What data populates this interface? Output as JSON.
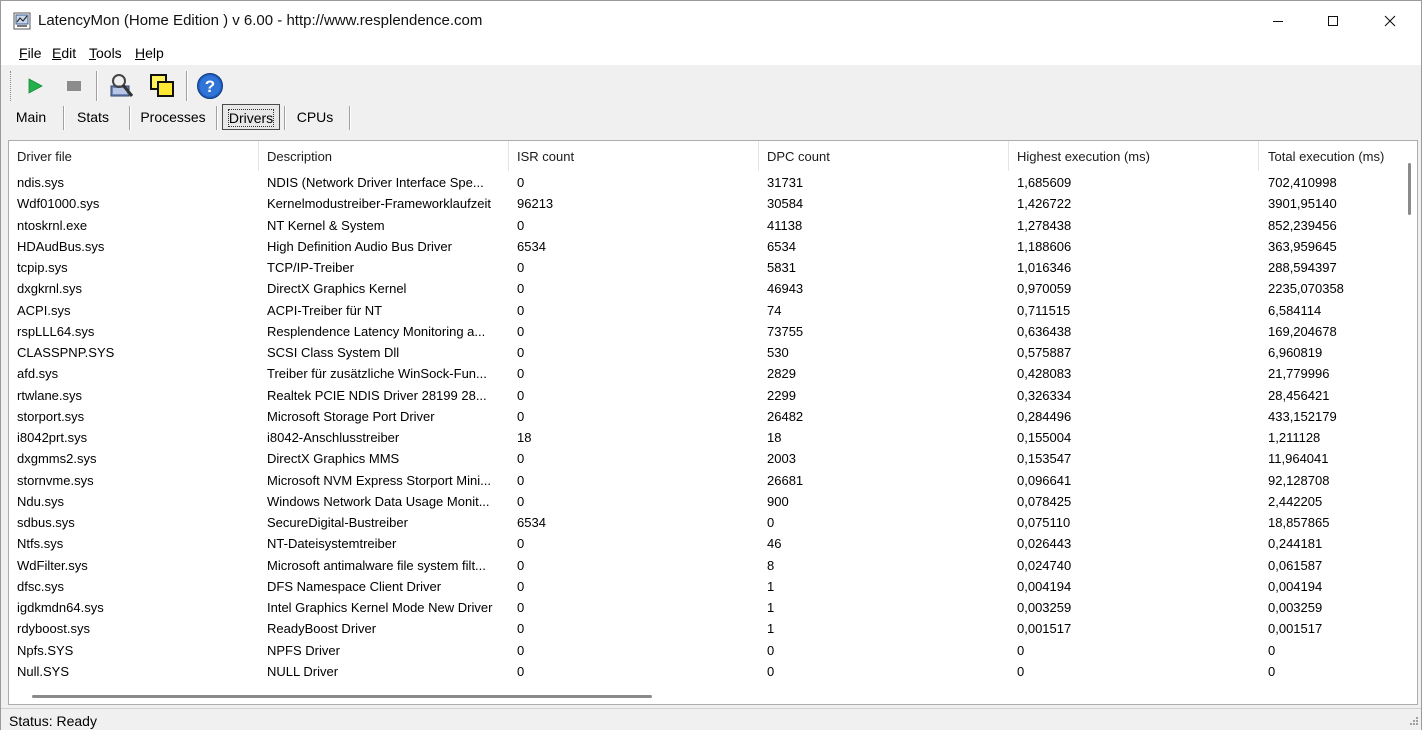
{
  "window": {
    "title": "LatencyMon  (Home Edition )  v 6.00 - http://www.resplendence.com"
  },
  "menu": [
    {
      "pre": "",
      "u": "F",
      "post": "ile"
    },
    {
      "pre": "",
      "u": "E",
      "post": "dit"
    },
    {
      "pre": "",
      "u": "T",
      "post": "ools"
    },
    {
      "pre": "",
      "u": "H",
      "post": "elp"
    }
  ],
  "toolbar": {
    "icons": [
      "play-icon",
      "stop-icon",
      "analyze-icon",
      "copy-windows-icon",
      "help-icon"
    ],
    "colors": {
      "play": "#22b14c",
      "stop": "#8c8c8c",
      "help": "#1f5fbf"
    }
  },
  "tabs": [
    {
      "label": "Main",
      "active": false
    },
    {
      "label": "Stats",
      "active": false
    },
    {
      "label": "Processes",
      "active": false
    },
    {
      "label": "Drivers",
      "active": true
    },
    {
      "label": "CPUs",
      "active": false
    }
  ],
  "table": {
    "columns": [
      "Driver file",
      "Description",
      "ISR count",
      "DPC count",
      "Highest execution (ms)",
      "Total execution (ms)"
    ],
    "rows": [
      [
        "ndis.sys",
        "NDIS (Network Driver Interface Spe...",
        "0",
        "31731",
        "1,685609",
        "702,410998"
      ],
      [
        "Wdf01000.sys",
        "Kernelmodustreiber-Frameworklaufzeit",
        "96213",
        "30584",
        "1,426722",
        "3901,95140"
      ],
      [
        "ntoskrnl.exe",
        "NT Kernel & System",
        "0",
        "41138",
        "1,278438",
        "852,239456"
      ],
      [
        "HDAudBus.sys",
        "High Definition Audio Bus Driver",
        "6534",
        "6534",
        "1,188606",
        "363,959645"
      ],
      [
        "tcpip.sys",
        "TCP/IP-Treiber",
        "0",
        "5831",
        "1,016346",
        "288,594397"
      ],
      [
        "dxgkrnl.sys",
        "DirectX Graphics Kernel",
        "0",
        "46943",
        "0,970059",
        "2235,070358"
      ],
      [
        "ACPI.sys",
        "ACPI-Treiber für NT",
        "0",
        "74",
        "0,711515",
        "6,584114"
      ],
      [
        "rspLLL64.sys",
        "Resplendence Latency Monitoring a...",
        "0",
        "73755",
        "0,636438",
        "169,204678"
      ],
      [
        "CLASSPNP.SYS",
        "SCSI Class System Dll",
        "0",
        "530",
        "0,575887",
        "6,960819"
      ],
      [
        "afd.sys",
        "Treiber für zusätzliche WinSock-Fun...",
        "0",
        "2829",
        "0,428083",
        "21,779996"
      ],
      [
        "rtwlane.sys",
        "Realtek PCIE NDIS Driver 28199 28...",
        "0",
        "2299",
        "0,326334",
        "28,456421"
      ],
      [
        "storport.sys",
        "Microsoft Storage Port Driver",
        "0",
        "26482",
        "0,284496",
        "433,152179"
      ],
      [
        "i8042prt.sys",
        "i8042-Anschlusstreiber",
        "18",
        "18",
        "0,155004",
        "1,211128"
      ],
      [
        "dxgmms2.sys",
        "DirectX Graphics MMS",
        "0",
        "2003",
        "0,153547",
        "11,964041"
      ],
      [
        "stornvme.sys",
        "Microsoft NVM Express Storport Mini...",
        "0",
        "26681",
        "0,096641",
        "92,128708"
      ],
      [
        "Ndu.sys",
        "Windows Network Data Usage Monit...",
        "0",
        "900",
        "0,078425",
        "2,442205"
      ],
      [
        "sdbus.sys",
        "SecureDigital-Bustreiber",
        "6534",
        "0",
        "0,075110",
        "18,857865"
      ],
      [
        "Ntfs.sys",
        "NT-Dateisystemtreiber",
        "0",
        "46",
        "0,026443",
        "0,244181"
      ],
      [
        "WdFilter.sys",
        "Microsoft antimalware file system filt...",
        "0",
        "8",
        "0,024740",
        "0,061587"
      ],
      [
        "dfsc.sys",
        "DFS Namespace Client Driver",
        "0",
        "1",
        "0,004194",
        "0,004194"
      ],
      [
        "igdkmdn64.sys",
        "Intel Graphics Kernel Mode New Driver",
        "0",
        "1",
        "0,003259",
        "0,003259"
      ],
      [
        "rdyboost.sys",
        "ReadyBoost Driver",
        "0",
        "1",
        "0,001517",
        "0,001517"
      ],
      [
        "Npfs.SYS",
        "NPFS Driver",
        "0",
        "0",
        "0",
        "0"
      ],
      [
        "Null.SYS",
        "NULL Driver",
        "0",
        "0",
        "0",
        "0"
      ]
    ]
  },
  "status": {
    "text": "Status: Ready"
  }
}
